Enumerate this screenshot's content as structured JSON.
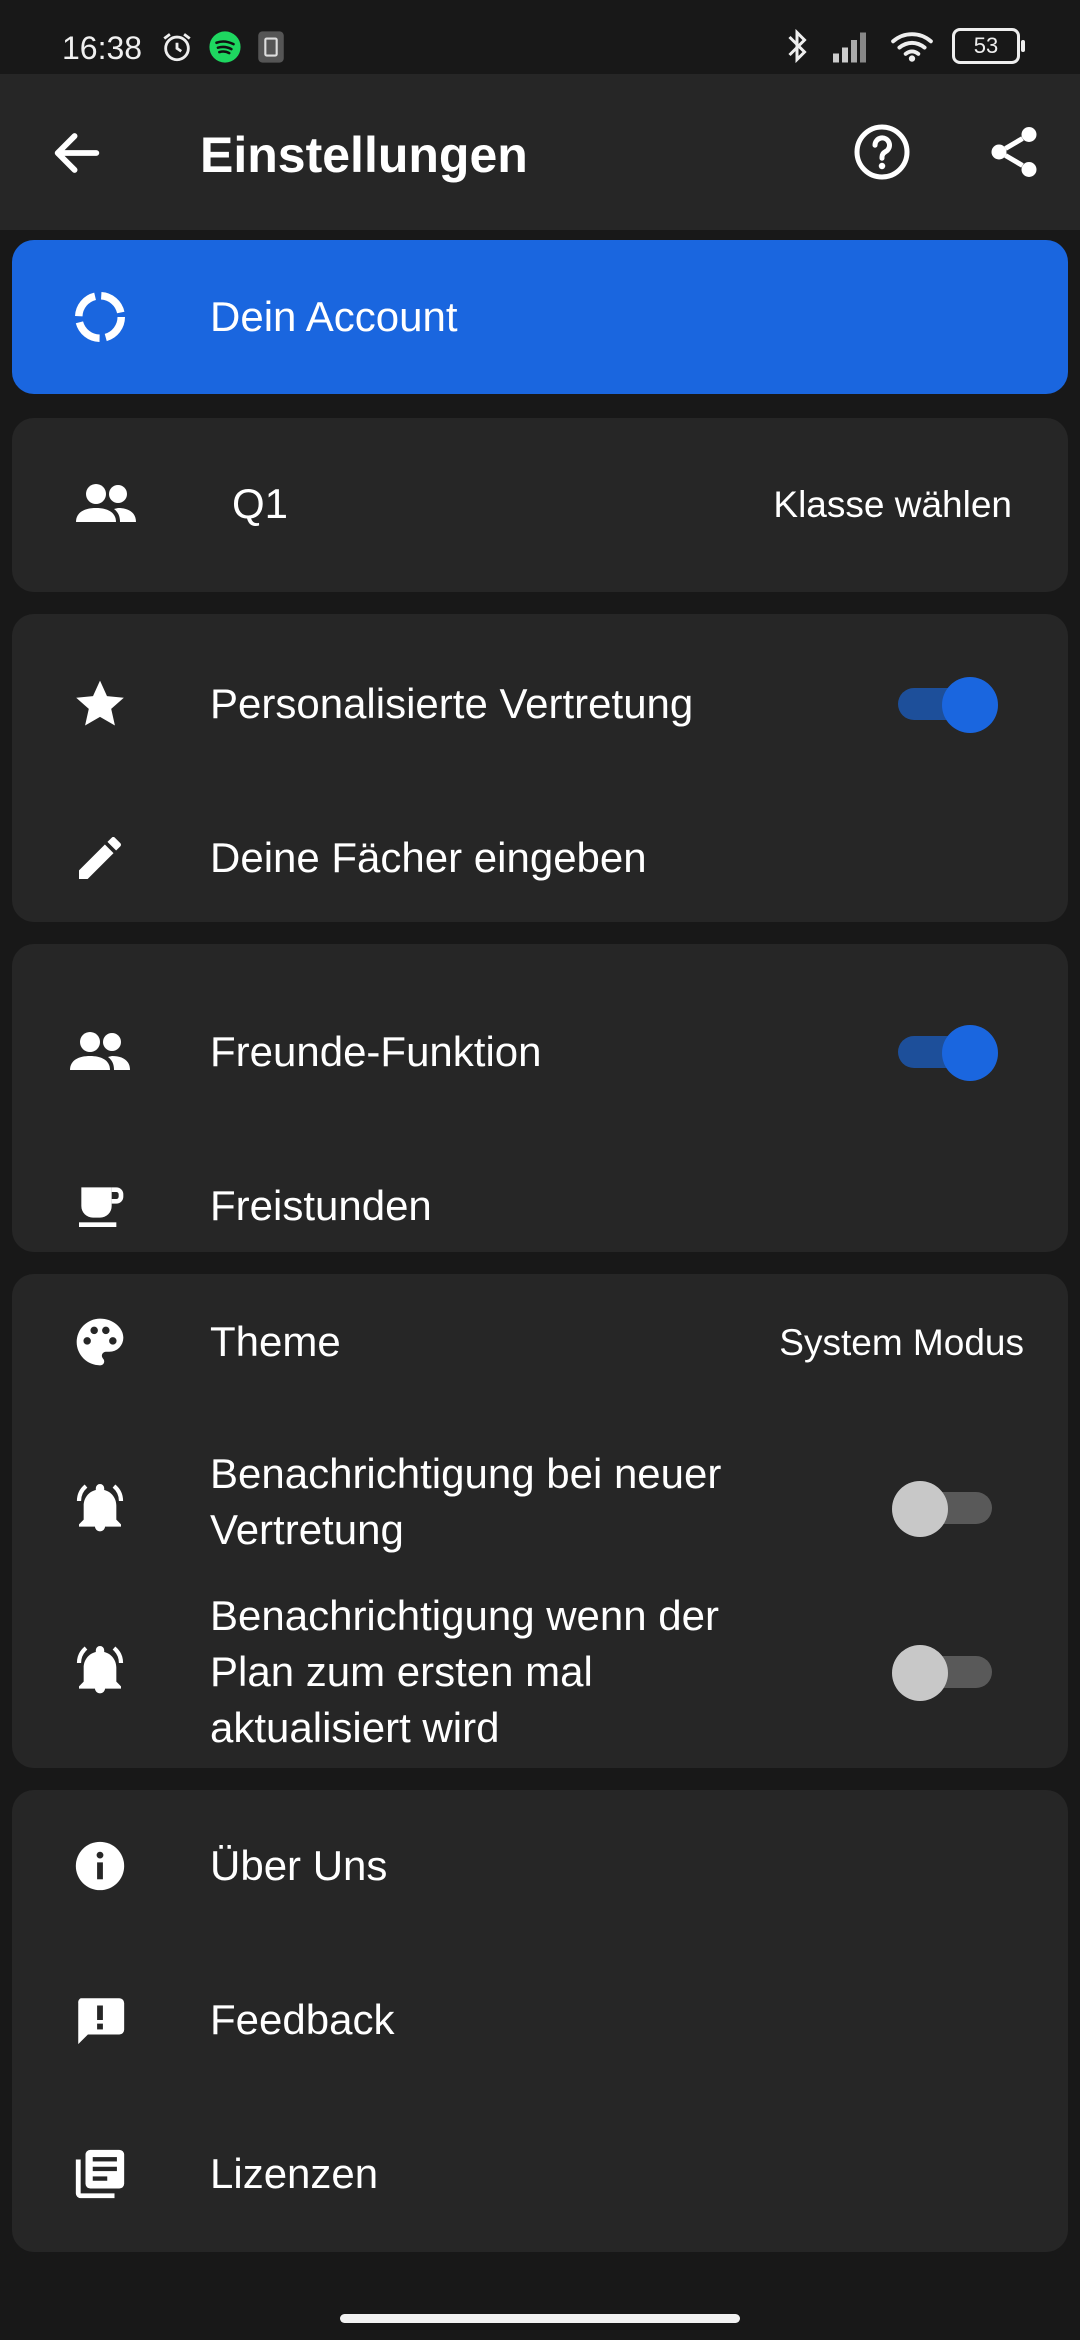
{
  "status_bar": {
    "time": "16:38",
    "battery": "53",
    "icons_left": [
      "alarm-icon",
      "spotify-icon",
      "sim-icon"
    ],
    "icons_right": [
      "bluetooth-icon",
      "signal-icon",
      "wifi-icon",
      "battery-icon"
    ]
  },
  "app_bar": {
    "title": "Einstellungen",
    "back_icon": "arrow-left-icon",
    "help_icon": "help-circle-icon",
    "share_icon": "share-icon"
  },
  "account": {
    "label": "Dein Account",
    "icon": "account-ring-icon"
  },
  "class_card": {
    "value": "Q1",
    "action": "Klasse wählen",
    "icon": "group-icon"
  },
  "personal_card": {
    "items": [
      {
        "label": "Personalisierte Vertretung",
        "icon": "star-icon",
        "toggle": true
      },
      {
        "label": "Deine Fächer eingeben",
        "icon": "pencil-icon"
      }
    ]
  },
  "friends_card": {
    "items": [
      {
        "label": "Freunde-Funktion",
        "icon": "group-icon",
        "toggle": true
      },
      {
        "label": "Freistunden",
        "icon": "coffee-icon"
      }
    ]
  },
  "theme_card": {
    "theme_label": "Theme",
    "theme_value": "System Modus",
    "notify_new_line1": "Benachrichtigung bei neuer",
    "notify_new_line2": "Vertretung",
    "notify_new_toggle": false,
    "notify_update_line1": "Benachrichtigung wenn der",
    "notify_update_line2": "Plan zum ersten mal",
    "notify_update_line3": "aktualisiert wird",
    "notify_update_toggle": false
  },
  "info_card": {
    "items": [
      {
        "label": "Über Uns",
        "icon": "info-icon"
      },
      {
        "label": "Feedback",
        "icon": "feedback-icon"
      },
      {
        "label": "Lizenzen",
        "icon": "library-books-icon"
      }
    ]
  },
  "colors": {
    "accent": "#1a66df",
    "card": "#262626",
    "background": "#181818"
  }
}
